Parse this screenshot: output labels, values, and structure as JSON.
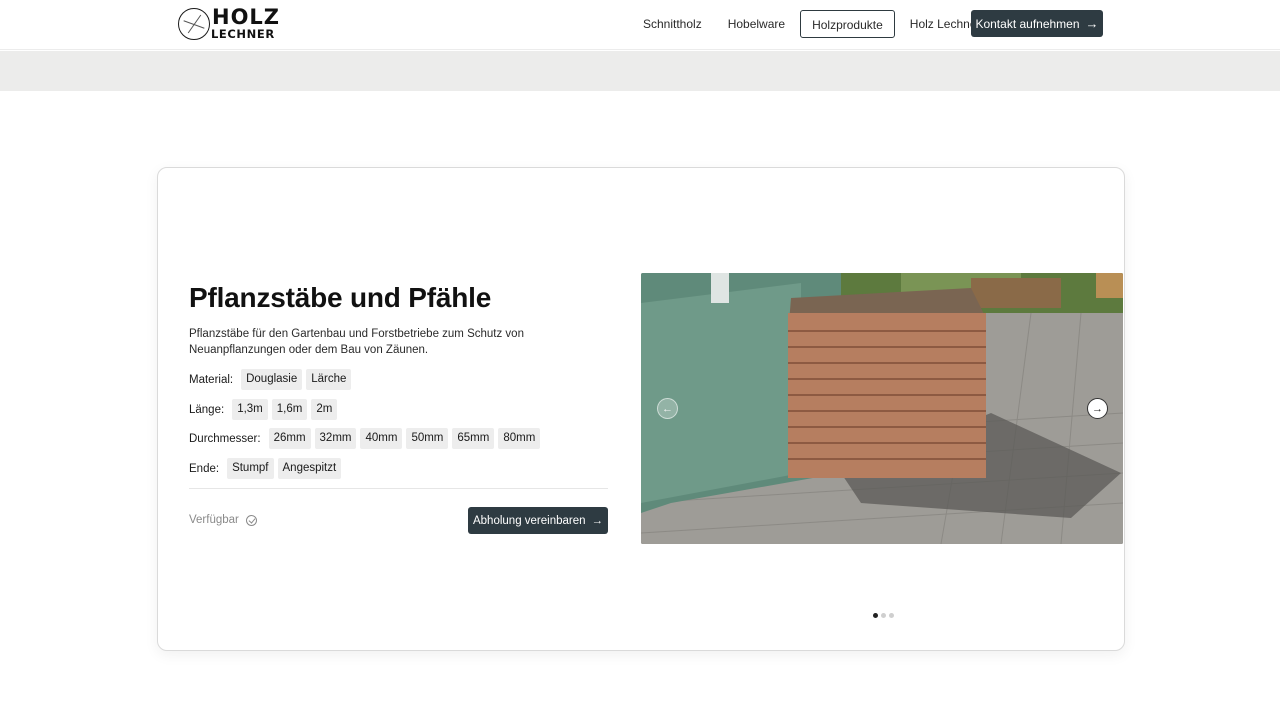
{
  "header": {
    "logo_top": "HOLZ",
    "logo_bottom": "LECHNER",
    "nav": [
      "Schnittholz",
      "Hobelware",
      "Holzprodukte",
      "Holz Lechner"
    ],
    "active_nav": "Holzprodukte",
    "cta_label": "Kontakt aufnehmen"
  },
  "product": {
    "title": "Pflanzstäbe und Pfähle",
    "description": "Pflanzstäbe für den Gartenbau und Forstbetriebe zum Schutz von Neuanpflanzungen oder dem Bau von Zäunen.",
    "attributes": [
      {
        "label": "Material:",
        "values": [
          "Douglasie",
          "Lärche"
        ]
      },
      {
        "label": "Länge:",
        "values": [
          "1,3m",
          "1,6m",
          "2m"
        ]
      },
      {
        "label": "Durchmesser:",
        "values": [
          "26mm",
          "32mm",
          "40mm",
          "50mm",
          "65mm",
          "80mm"
        ]
      },
      {
        "label": "Ende:",
        "values": [
          "Stumpf",
          "Angespitzt"
        ]
      }
    ],
    "availability": "Verfügbar",
    "pickup_label": "Abholung vereinbaren"
  },
  "slider": {
    "prev_icon": "arrow-left-icon",
    "next_icon": "arrow-right-icon",
    "dot_count": 3,
    "active_dot": 0
  },
  "colors": {
    "primary_button": "#2e3b42",
    "chip_bg": "#ededed",
    "band": "#ececeb"
  }
}
